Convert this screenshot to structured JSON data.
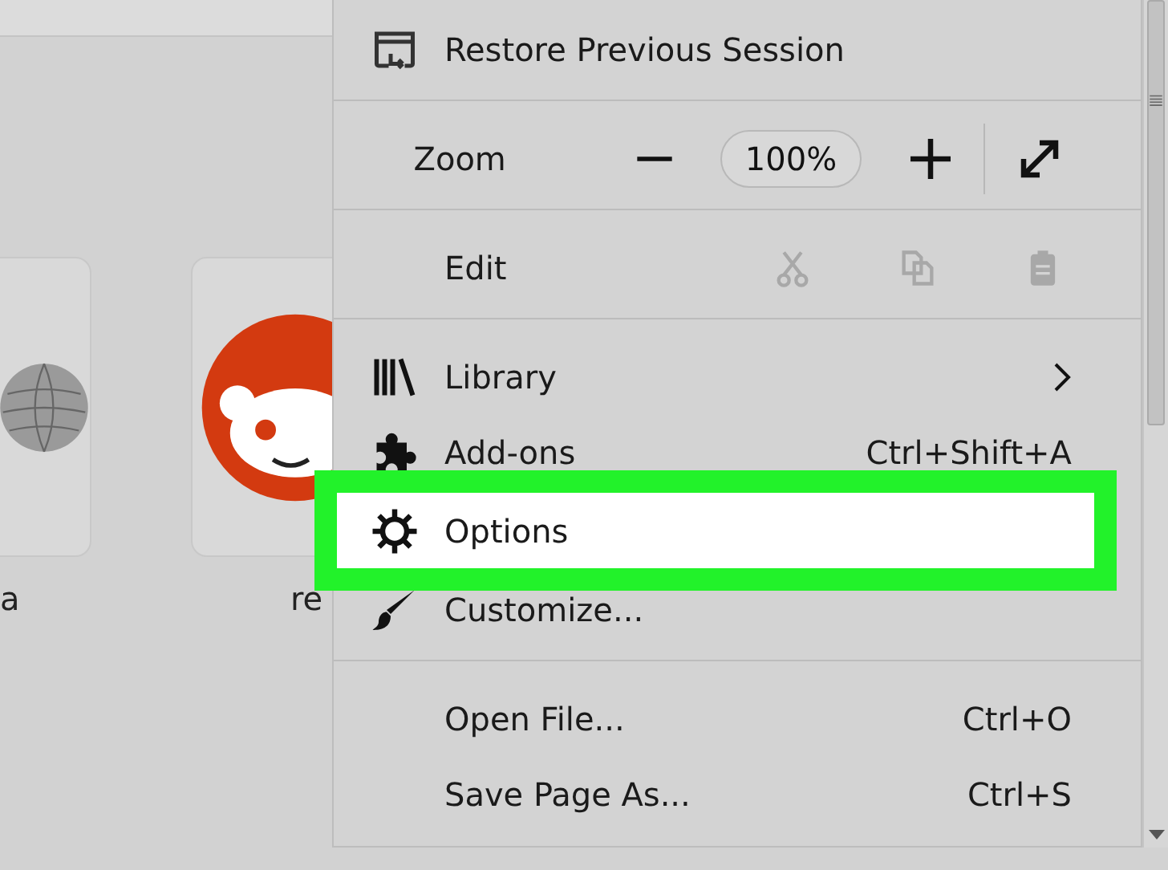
{
  "tiles": [
    {
      "label": "a",
      "kind": "globe"
    },
    {
      "label": "re",
      "kind": "reddit"
    }
  ],
  "menu": {
    "items": [
      {
        "kind": "item",
        "label": "Restore Previous Session",
        "selected": false
      },
      {
        "kind": "separator"
      },
      {
        "kind": "zoom",
        "label": "Zoom",
        "value": "100%"
      },
      {
        "kind": "separator"
      },
      {
        "kind": "edit",
        "label": "Edit",
        "actions": [
          {
            "disabled": true
          },
          {
            "disabled": true
          },
          {
            "disabled": true
          }
        ]
      },
      {
        "kind": "separator"
      },
      {
        "kind": "item",
        "label": "Library",
        "submenu": true,
        "selected": false
      },
      {
        "kind": "item",
        "label": "Add-ons",
        "shortcut": "Ctrl+Shift+A",
        "selected": false
      },
      {
        "kind": "item",
        "label": "Options",
        "selected": true
      },
      {
        "kind": "item",
        "label": "Customize...",
        "selected": false
      },
      {
        "kind": "separator"
      },
      {
        "kind": "item",
        "label": "Open File...",
        "shortcut": "Ctrl+O",
        "selected": false
      },
      {
        "kind": "item",
        "label": "Save Page As...",
        "shortcut": "Ctrl+S",
        "selected": false
      }
    ]
  }
}
